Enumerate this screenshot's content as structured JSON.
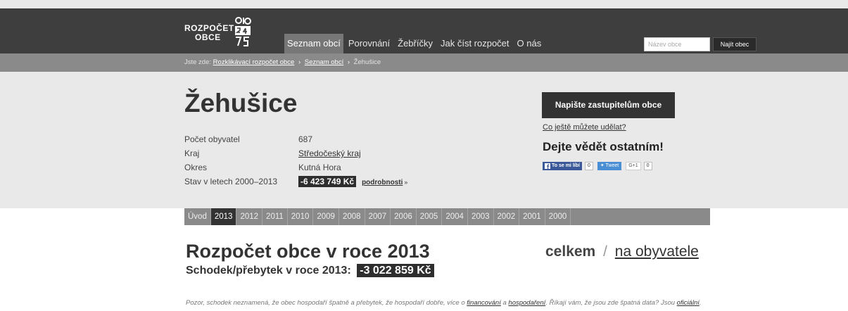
{
  "logo": {
    "line1": "ROZPOČET",
    "line2": "OBCE"
  },
  "nav": {
    "items": [
      {
        "label": "Seznam obcí"
      },
      {
        "label": "Porovnání"
      },
      {
        "label": "Žebříčky"
      },
      {
        "label": "Jak číst rozpočet"
      },
      {
        "label": "O nás"
      }
    ],
    "active_index": 0,
    "search": {
      "placeholder": "Název obce",
      "value": ""
    },
    "search_button": "Najít obec"
  },
  "breadcrumb": {
    "prefix": "Jste zde:",
    "links": [
      "Rozklikávací rozpočet obce",
      "Seznam obcí"
    ],
    "current": "Žehušice",
    "separator": "›"
  },
  "town": {
    "name": "Žehušice",
    "facts": [
      {
        "label": "Počet obyvatel",
        "value": "687"
      },
      {
        "label": "Kraj",
        "value": "Středočeský kraj"
      },
      {
        "label": "Okres",
        "value": "Kutná Hora"
      },
      {
        "label": "Stav v letech 2000–2013",
        "value": "-6 423 749 Kč"
      }
    ],
    "details_label": "podrobnosti",
    "details_chevron": "»"
  },
  "actions": {
    "write_button": "Napište zastupitelům obce",
    "more_link": "Co ještě můžete udělat?",
    "share_heading": "Dejte vědět ostatním!",
    "facebook_label": "To se mi líbí",
    "facebook_count": "0",
    "tweet_label": "Tweet",
    "gplus_label": "G+1",
    "gplus_count": "0"
  },
  "years": {
    "tabs": [
      "Úvod",
      "2013",
      "2012",
      "2011",
      "2010",
      "2009",
      "2008",
      "2007",
      "2006",
      "2005",
      "2004",
      "2003",
      "2002",
      "2001",
      "2000"
    ],
    "active": "2013"
  },
  "budget": {
    "title": "Rozpočet obce v roce 2013",
    "subtitle": "Schodek/přebytek v roce 2013:",
    "value": "-3 022 859 Kč",
    "view_total": "celkem",
    "view_separator": "/",
    "view_per_capita": "na obyvatele"
  },
  "note": {
    "text1": "Pozor, schodek neznamená, že obec hospodaří špatně a přebytek, že hospodaří dobře, více o ",
    "link1": "financování",
    "text2": " a ",
    "link2": "hospodaření",
    "text3": ". Říkají vám, že jsou zde špatná data? Jsou ",
    "link3": "oficiální",
    "text4": "."
  },
  "colors": {
    "nav_bg": "#3e3e3e",
    "breadcrumb_bg": "#8a8a8a",
    "header_bg": "#e9e9e9",
    "badge_bg": "#2e2e2e",
    "active_tab": "#333333"
  }
}
